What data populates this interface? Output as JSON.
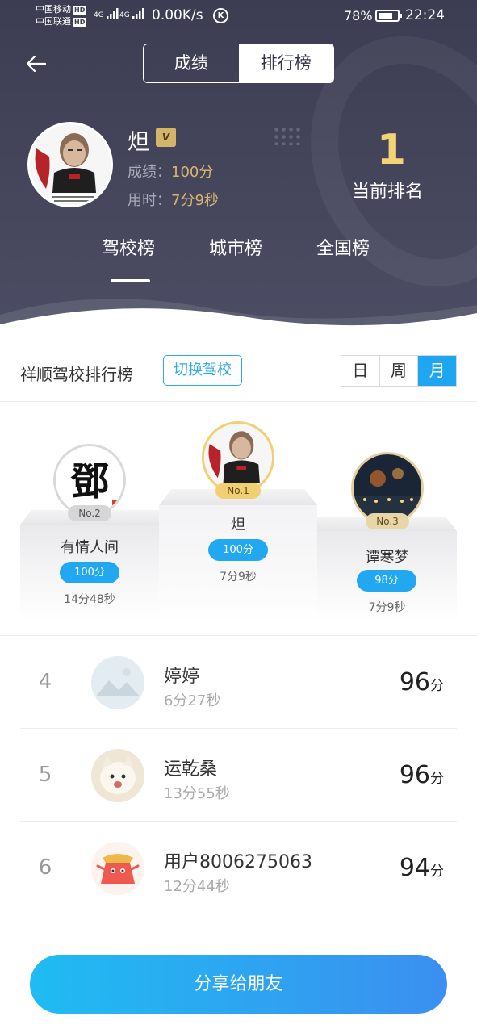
{
  "status_bar": {
    "carrier1": "中国移动",
    "carrier2": "中国联通",
    "hd": "HD",
    "net1": "4G",
    "net2": "4G",
    "speed": "0.00K/s",
    "battery_pct": "78%",
    "battery_level": 0.78,
    "time": "22:24"
  },
  "header": {
    "tabs": [
      {
        "label": "成绩",
        "active": false
      },
      {
        "label": "排行榜",
        "active": true
      }
    ]
  },
  "profile": {
    "name": "炟",
    "vip_badge": "VIP",
    "score_label": "成绩：",
    "score_value": "100分",
    "time_label": "用时：",
    "time_value": "7分9秒",
    "rank": "1",
    "rank_label": "当前排名"
  },
  "scope_tabs": [
    {
      "label": "驾校榜",
      "active": true
    },
    {
      "label": "城市榜",
      "active": false
    },
    {
      "label": "全国榜",
      "active": false
    }
  ],
  "school": {
    "title": "祥顺驾校排行榜",
    "switch_label": "切换驾校",
    "periods": [
      {
        "label": "日",
        "active": false
      },
      {
        "label": "周",
        "active": false
      },
      {
        "label": "月",
        "active": true
      }
    ]
  },
  "podium": {
    "first": {
      "badge": "No.1",
      "name": "炟",
      "score": "100分",
      "time": "7分9秒"
    },
    "second": {
      "badge": "No.2",
      "name": "有情人间",
      "score": "100分",
      "time": "14分48秒",
      "avatar_glyph": "鄧"
    },
    "third": {
      "badge": "No.3",
      "name": "谭寒梦",
      "score": "98分",
      "time": "7分9秒"
    }
  },
  "list": [
    {
      "rank": "4",
      "name": "婷婷",
      "time": "6分27秒",
      "score": "96",
      "unit": "分"
    },
    {
      "rank": "5",
      "name": "运乾桑",
      "time": "13分55秒",
      "score": "96",
      "unit": "分"
    },
    {
      "rank": "6",
      "name": "用户8006275063",
      "time": "12分44秒",
      "score": "94",
      "unit": "分"
    }
  ],
  "share_button": "分享给朋友",
  "colors": {
    "header_bg": "#3c3d52",
    "accent_blue": "#1ea7f0",
    "gold": "#f2d474",
    "gold_text": "#d8b671"
  }
}
